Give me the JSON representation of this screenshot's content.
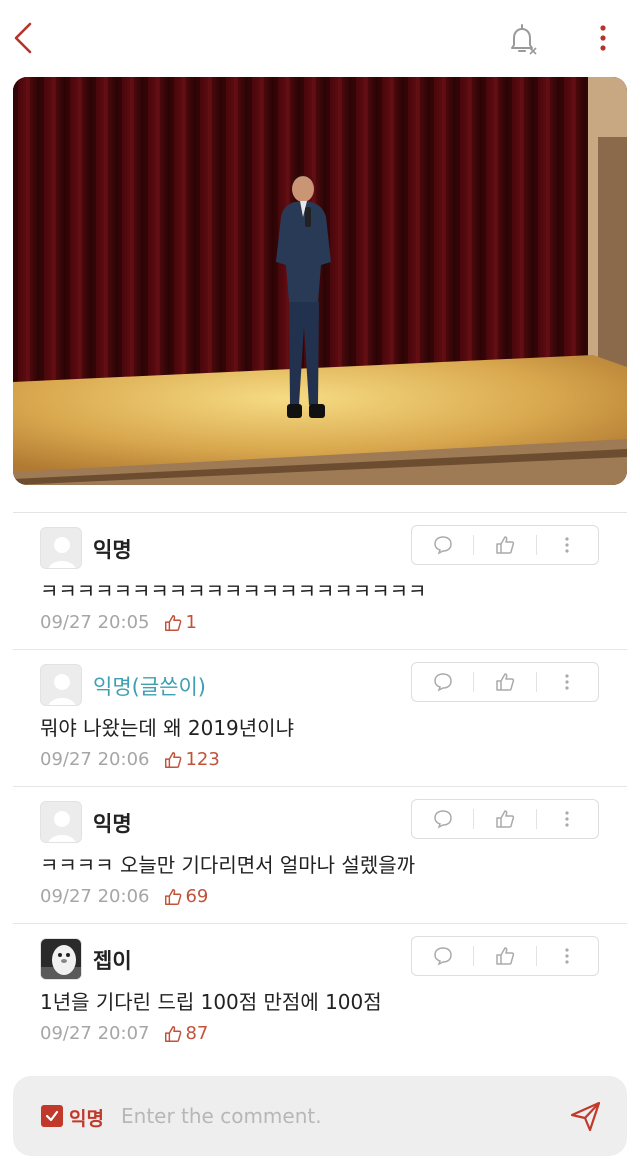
{
  "header": {
    "back_icon": "chevron-left-icon",
    "notify_icon": "bell-off-icon",
    "more_icon": "vertical-dots-icon"
  },
  "colors": {
    "accent": "#c0392b",
    "op_name": "#3f9fb2",
    "like": "#c0533a",
    "meta": "#a6a6a6"
  },
  "comments": [
    {
      "author": "익명",
      "is_op": false,
      "text": "ㅋㅋㅋㅋㅋㅋㅋㅋㅋㅋㅋㅋㅋㅋㅋㅋㅋㅋㅋㅋㅋ",
      "time": "09/27 20:05",
      "likes": "1"
    },
    {
      "author": "익명(글쓴이)",
      "is_op": true,
      "text": "뭐야 나왔는데 왜 2019년이냐",
      "time": "09/27 20:06",
      "likes": "123"
    },
    {
      "author": "익명",
      "is_op": false,
      "text": "ㅋㅋㅋㅋ 오늘만 기다리면서 얼마나 설렜을까",
      "time": "09/27 20:06",
      "likes": "69"
    },
    {
      "author": "젭이",
      "is_op": false,
      "text": "1년을 기다린 드립 100점 만점에 100점",
      "time": "09/27 20:07",
      "likes": "87"
    }
  ],
  "composer": {
    "anon_label": "익명",
    "anon_checked": true,
    "placeholder": "Enter the comment."
  }
}
